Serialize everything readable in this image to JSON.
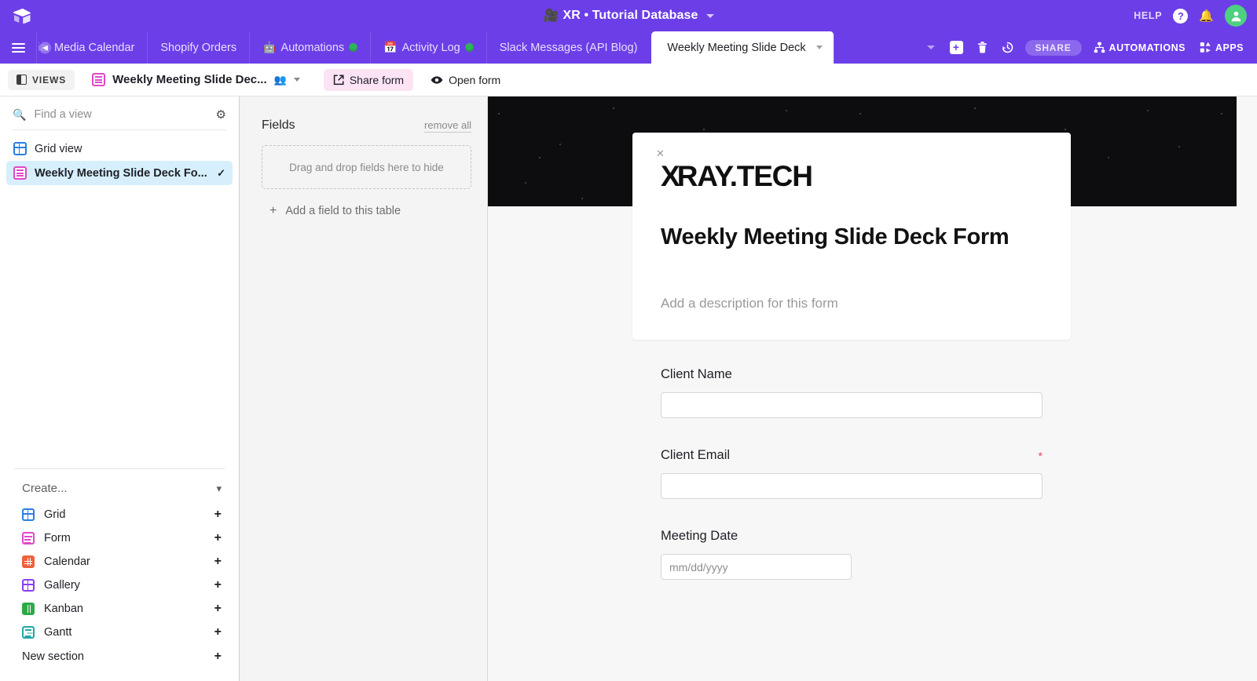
{
  "header": {
    "title_emoji": "🎥",
    "title": "XR • Tutorial Database",
    "help_label": "HELP",
    "help_icon": "question-mark-icon",
    "bell_icon": "bell-icon",
    "avatar_icon": "user-avatar",
    "avatar_color": "#4dd07f",
    "background": "#6c3ee8"
  },
  "tabs": {
    "menu_icon": "hamburger-icon",
    "items": [
      {
        "label": "Media Calendar",
        "emoji": "",
        "dot": false,
        "active": false,
        "cut": true,
        "ghost": "ia"
      },
      {
        "label": "Shopify Orders",
        "emoji": "",
        "dot": false,
        "active": false
      },
      {
        "label": "Automations",
        "emoji": "🤖",
        "dot": true,
        "active": false
      },
      {
        "label": "Activity Log",
        "emoji": "📅",
        "dot": true,
        "active": false
      },
      {
        "label": "Slack Messages (API Blog)",
        "emoji": "",
        "dot": false,
        "active": false
      },
      {
        "label": "Weekly Meeting Slide Deck",
        "emoji": "",
        "dot": false,
        "active": true
      }
    ],
    "right": {
      "add_table_icon": "plus-box-icon",
      "trash_icon": "trash-icon",
      "history_icon": "history-clock-icon",
      "share_label": "SHARE",
      "automations_label": "AUTOMATIONS",
      "automations_icon": "automations-node-icon",
      "apps_label": "APPS",
      "apps_icon": "apps-grid-icon"
    }
  },
  "toolbar": {
    "views_label": "VIEWS",
    "views_icon": "panel-icon",
    "view_name": "Weekly Meeting Slide Dec...",
    "view_icon": "form-view-icon",
    "collaborators_icon": "people-icon",
    "share_form_label": "Share form",
    "share_form_icon": "external-link-icon",
    "open_form_label": "Open form",
    "open_form_icon": "eye-icon"
  },
  "sidebar": {
    "search_placeholder": "Find a view",
    "search_icon": "search-icon",
    "settings_icon": "gear-icon",
    "views": [
      {
        "label": "Grid view",
        "icon": "grid-view-icon",
        "color": "#2a7fe0",
        "selected": false
      },
      {
        "label": "Weekly Meeting Slide Deck Fo...",
        "icon": "form-view-icon",
        "color": "#e247c9",
        "selected": true
      }
    ],
    "create_label": "Create...",
    "create_chevron": "chevron-down-icon",
    "create_items": [
      {
        "label": "Grid",
        "color": "#2a7fe0",
        "swatch": "blue"
      },
      {
        "label": "Form",
        "color": "#e247c9",
        "swatch": "pink"
      },
      {
        "label": "Calendar",
        "color": "#f0603c",
        "swatch": "orange"
      },
      {
        "label": "Gallery",
        "color": "#8b3df2",
        "swatch": "purple"
      },
      {
        "label": "Kanban",
        "color": "#2faa4a",
        "swatch": "green"
      },
      {
        "label": "Gantt",
        "color": "#22a6a6",
        "swatch": "teal"
      }
    ],
    "new_section_label": "New section",
    "plus_label": "+"
  },
  "fields_panel": {
    "title": "Fields",
    "remove_all_label": "remove all",
    "dropzone_text": "Drag and drop fields here to hide",
    "add_field_label": "Add a field to this table",
    "add_field_icon": "plus-icon"
  },
  "form_preview": {
    "close_icon": "close-icon",
    "logo_text": "XRAY.TECH",
    "logo_lead": "X",
    "logo_rest": "RAY.TECH",
    "title": "Weekly Meeting Slide Deck Form",
    "description_placeholder": "Add a description for this form",
    "cover_alt": "starfield-cover-image",
    "fields": [
      {
        "label": "Client Name",
        "required": false,
        "placeholder": "",
        "type": "text"
      },
      {
        "label": "Client Email",
        "required": true,
        "placeholder": "",
        "type": "text"
      },
      {
        "label": "Meeting Date",
        "required": false,
        "placeholder": "mm/dd/yyyy",
        "type": "date"
      }
    ],
    "required_marker": "*"
  }
}
